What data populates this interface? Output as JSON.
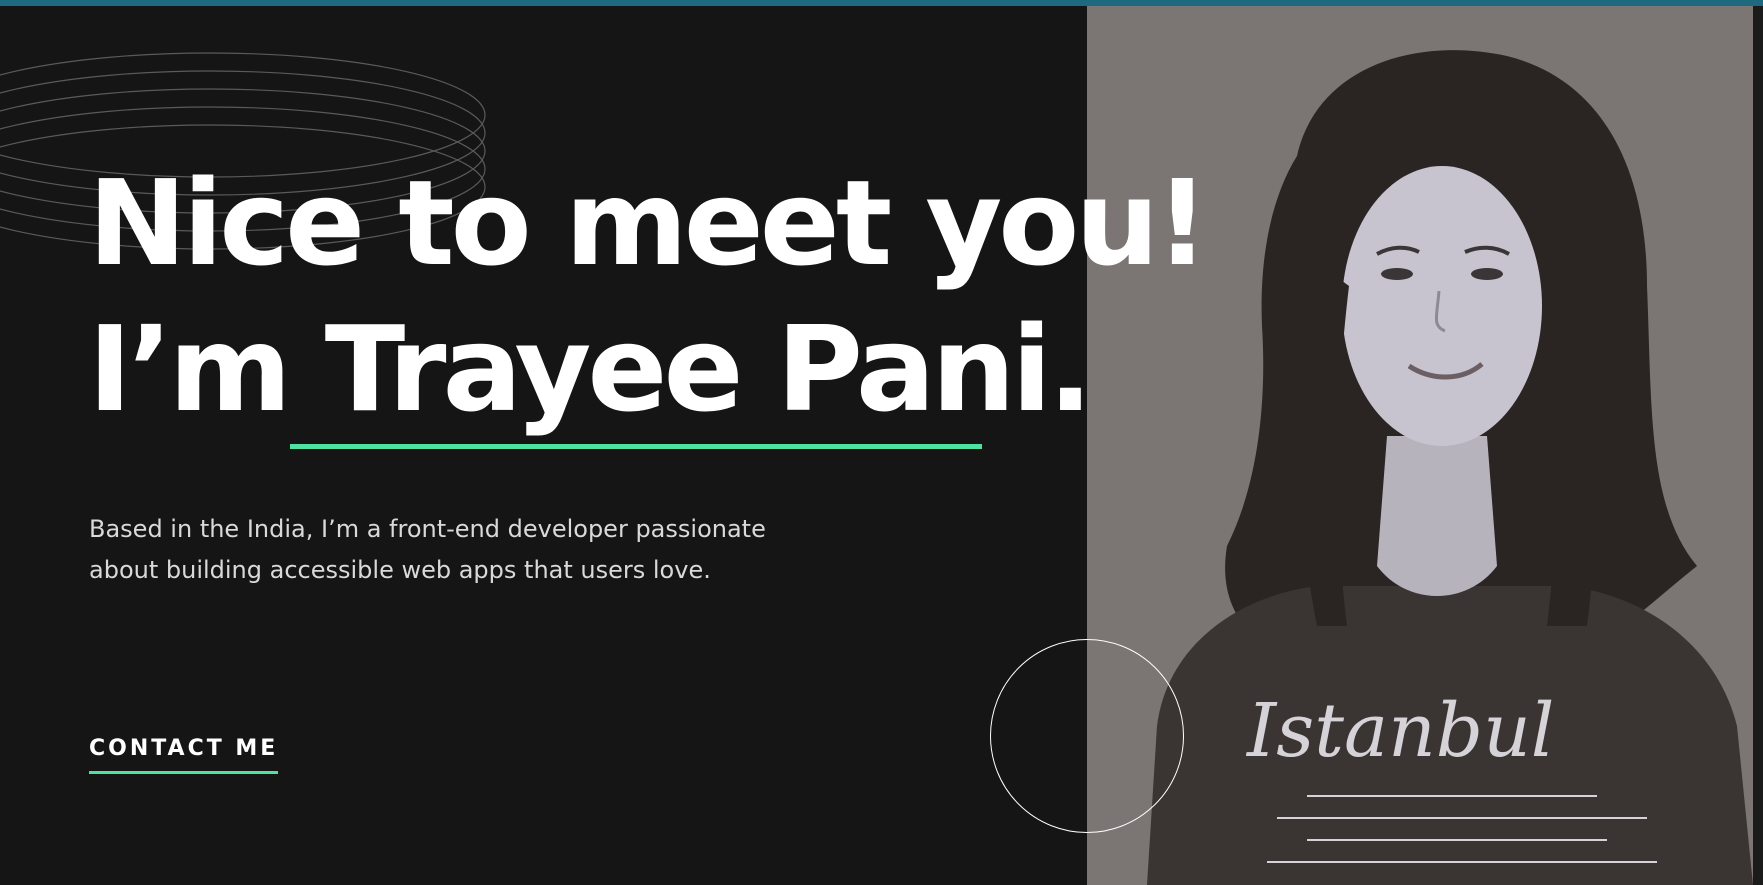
{
  "hero": {
    "headline_line1": "Nice to meet you!",
    "headline_prefix": "I’m ",
    "headline_name": "Trayee Pani.",
    "intro": "Based in the India, I’m a front-end developer passionate about building accessible web apps that users love.",
    "contact_label": "CONTACT ME"
  },
  "photo": {
    "shirt_text": "Istanbul"
  },
  "colors": {
    "accent": "#4ee1a0",
    "background": "#151515",
    "text": "#ffffff",
    "top_bar": "#1d6a7e"
  }
}
